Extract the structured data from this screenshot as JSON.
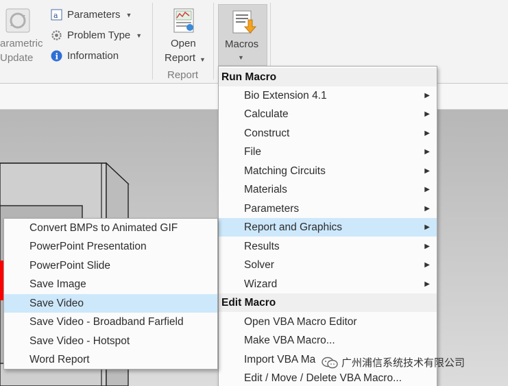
{
  "ribbon": {
    "parametric_update": {
      "line1": "arametric",
      "line2": "Update"
    },
    "parameters_label": "Parameters",
    "problem_type_label": "Problem Type",
    "information_label": "Information",
    "open_report": {
      "line1": "Open",
      "line2": "Report"
    },
    "report_group_label": "Report",
    "macros_label": "Macros"
  },
  "main_menu": {
    "run_header": "Run Macro",
    "run_items": [
      {
        "label": "Bio Extension 4.1"
      },
      {
        "label": "Calculate"
      },
      {
        "label": "Construct"
      },
      {
        "label": "File"
      },
      {
        "label": "Matching Circuits"
      },
      {
        "label": "Materials"
      },
      {
        "label": "Parameters"
      },
      {
        "label": "Report and Graphics"
      },
      {
        "label": "Results"
      },
      {
        "label": "Solver"
      },
      {
        "label": "Wizard"
      }
    ],
    "edit_header": "Edit Macro",
    "edit_items": [
      {
        "label": "Open VBA Macro Editor"
      },
      {
        "label": "Make VBA Macro..."
      },
      {
        "label": "Import VBA Ma"
      },
      {
        "label": "Edit / Move / Delete VBA Macro..."
      }
    ]
  },
  "sub_menu": {
    "items": [
      {
        "label": "Convert BMPs to Animated GIF"
      },
      {
        "label": "PowerPoint Presentation"
      },
      {
        "label": "PowerPoint Slide"
      },
      {
        "label": "Save Image"
      },
      {
        "label": "Save Video"
      },
      {
        "label": "Save Video - Broadband Farfield"
      },
      {
        "label": "Save Video - Hotspot"
      },
      {
        "label": "Word Report"
      }
    ]
  },
  "watermark": {
    "text": "广州浦信系统技术有限公司"
  },
  "colors": {
    "highlight": "#cde8fb",
    "model_red": "#ff0000"
  }
}
